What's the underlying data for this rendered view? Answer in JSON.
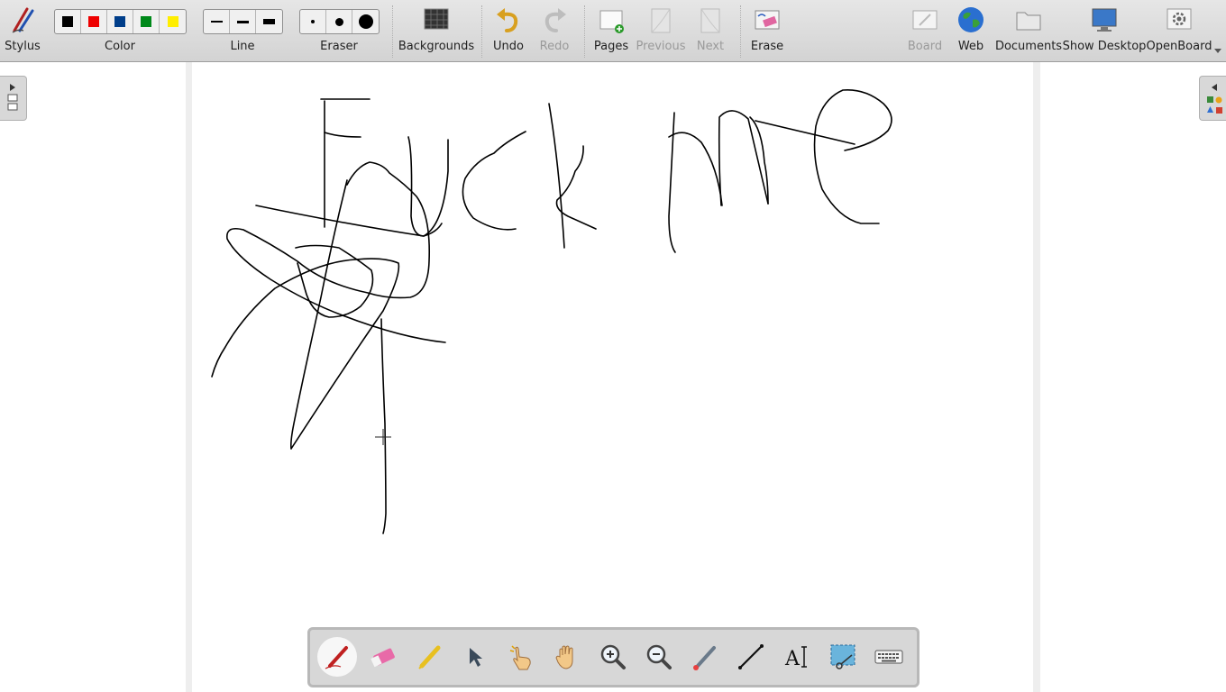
{
  "toolbar": {
    "stylus": "Stylus",
    "color": "Color",
    "line": "Line",
    "eraser": "Eraser",
    "backgrounds": "Backgrounds",
    "undo": "Undo",
    "redo": "Redo",
    "pages": "Pages",
    "previous": "Previous",
    "next": "Next",
    "erase": "Erase",
    "board": "Board",
    "web": "Web",
    "documents": "Documents",
    "show_desktop": "Show Desktop",
    "openboard": "OpenBoard",
    "palette_colors": [
      "#000000",
      "#ee0000",
      "#003e8a",
      "#00891a",
      "#ffee00"
    ]
  },
  "bottom_tools": [
    "pen",
    "eraser",
    "highlighter",
    "selector",
    "interact",
    "hand",
    "zoom-in",
    "zoom-out",
    "laser-pointer",
    "line",
    "text",
    "capture",
    "virtual-keyboard"
  ],
  "active_tool": "pen"
}
